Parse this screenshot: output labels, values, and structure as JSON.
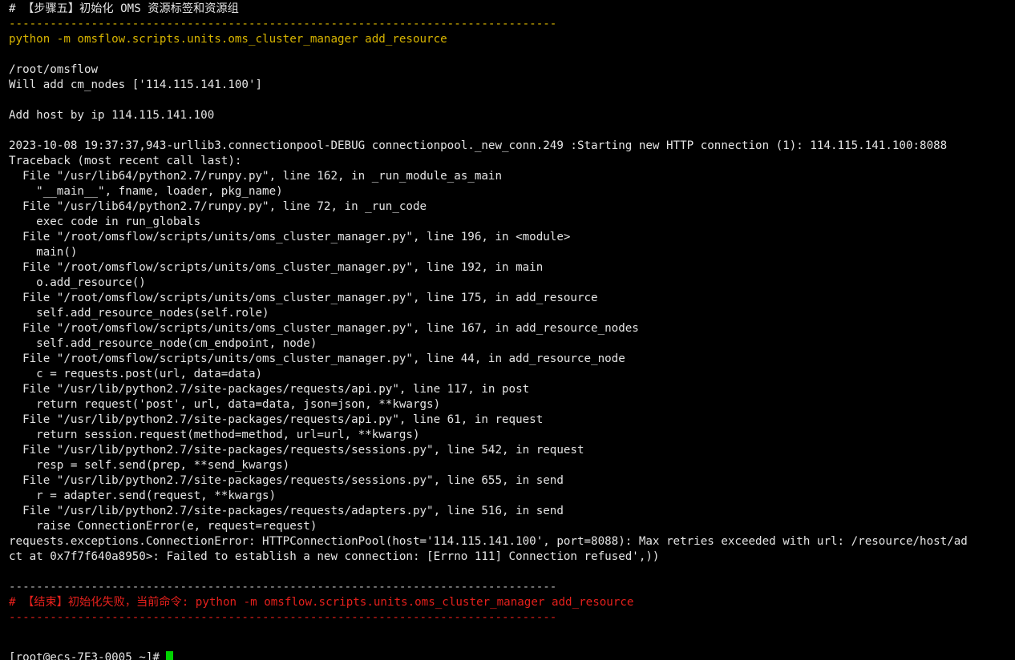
{
  "colors": {
    "background": "#000000",
    "text": "#e4e4e4",
    "command": "#d7b400",
    "error": "#e4201c",
    "cursor": "#00d400"
  },
  "terminal": {
    "lines": [
      {
        "text": "# 【步骤五】初始化 OMS 资源标签和资源组",
        "color": "white"
      },
      {
        "text": "--------------------------------------------------------------------------------",
        "color": "yellow"
      },
      {
        "text": "python -m omsflow.scripts.units.oms_cluster_manager add_resource",
        "color": "yellow"
      },
      {
        "text": "",
        "color": "white"
      },
      {
        "text": "/root/omsflow",
        "color": "white"
      },
      {
        "text": "Will add cm_nodes ['114.115.141.100']",
        "color": "white"
      },
      {
        "text": "",
        "color": "white"
      },
      {
        "text": "Add host by ip 114.115.141.100",
        "color": "white"
      },
      {
        "text": "",
        "color": "white"
      },
      {
        "text": "2023-10-08 19:37:37,943-urllib3.connectionpool-DEBUG connectionpool._new_conn.249 :Starting new HTTP connection (1): 114.115.141.100:8088",
        "color": "white"
      },
      {
        "text": "Traceback (most recent call last):",
        "color": "white"
      },
      {
        "text": "  File \"/usr/lib64/python2.7/runpy.py\", line 162, in _run_module_as_main",
        "color": "white"
      },
      {
        "text": "    \"__main__\", fname, loader, pkg_name)",
        "color": "white"
      },
      {
        "text": "  File \"/usr/lib64/python2.7/runpy.py\", line 72, in _run_code",
        "color": "white"
      },
      {
        "text": "    exec code in run_globals",
        "color": "white"
      },
      {
        "text": "  File \"/root/omsflow/scripts/units/oms_cluster_manager.py\", line 196, in <module>",
        "color": "white"
      },
      {
        "text": "    main()",
        "color": "white"
      },
      {
        "text": "  File \"/root/omsflow/scripts/units/oms_cluster_manager.py\", line 192, in main",
        "color": "white"
      },
      {
        "text": "    o.add_resource()",
        "color": "white"
      },
      {
        "text": "  File \"/root/omsflow/scripts/units/oms_cluster_manager.py\", line 175, in add_resource",
        "color": "white"
      },
      {
        "text": "    self.add_resource_nodes(self.role)",
        "color": "white"
      },
      {
        "text": "  File \"/root/omsflow/scripts/units/oms_cluster_manager.py\", line 167, in add_resource_nodes",
        "color": "white"
      },
      {
        "text": "    self.add_resource_node(cm_endpoint, node)",
        "color": "white"
      },
      {
        "text": "  File \"/root/omsflow/scripts/units/oms_cluster_manager.py\", line 44, in add_resource_node",
        "color": "white"
      },
      {
        "text": "    c = requests.post(url, data=data)",
        "color": "white"
      },
      {
        "text": "  File \"/usr/lib/python2.7/site-packages/requests/api.py\", line 117, in post",
        "color": "white"
      },
      {
        "text": "    return request('post', url, data=data, json=json, **kwargs)",
        "color": "white"
      },
      {
        "text": "  File \"/usr/lib/python2.7/site-packages/requests/api.py\", line 61, in request",
        "color": "white"
      },
      {
        "text": "    return session.request(method=method, url=url, **kwargs)",
        "color": "white"
      },
      {
        "text": "  File \"/usr/lib/python2.7/site-packages/requests/sessions.py\", line 542, in request",
        "color": "white"
      },
      {
        "text": "    resp = self.send(prep, **send_kwargs)",
        "color": "white"
      },
      {
        "text": "  File \"/usr/lib/python2.7/site-packages/requests/sessions.py\", line 655, in send",
        "color": "white"
      },
      {
        "text": "    r = adapter.send(request, **kwargs)",
        "color": "white"
      },
      {
        "text": "  File \"/usr/lib/python2.7/site-packages/requests/adapters.py\", line 516, in send",
        "color": "white"
      },
      {
        "text": "    raise ConnectionError(e, request=request)",
        "color": "white"
      },
      {
        "text": "requests.exceptions.ConnectionError: HTTPConnectionPool(host='114.115.141.100', port=8088): Max retries exceeded with url: /resource/host/ad",
        "color": "white"
      },
      {
        "text": "ct at 0x7f7f640a8950>: Failed to establish a new connection: [Errno 111] Connection refused',))",
        "color": "white"
      },
      {
        "text": "",
        "color": "white"
      },
      {
        "text": "--------------------------------------------------------------------------------",
        "color": "gray"
      },
      {
        "text": "# 【结束】初始化失败，当前命令: python -m omsflow.scripts.units.oms_cluster_manager add_resource",
        "color": "red"
      },
      {
        "text": "--------------------------------------------------------------------------------",
        "color": "red"
      }
    ],
    "prompt": "[root@ecs-7E3-0005 ~]# "
  }
}
